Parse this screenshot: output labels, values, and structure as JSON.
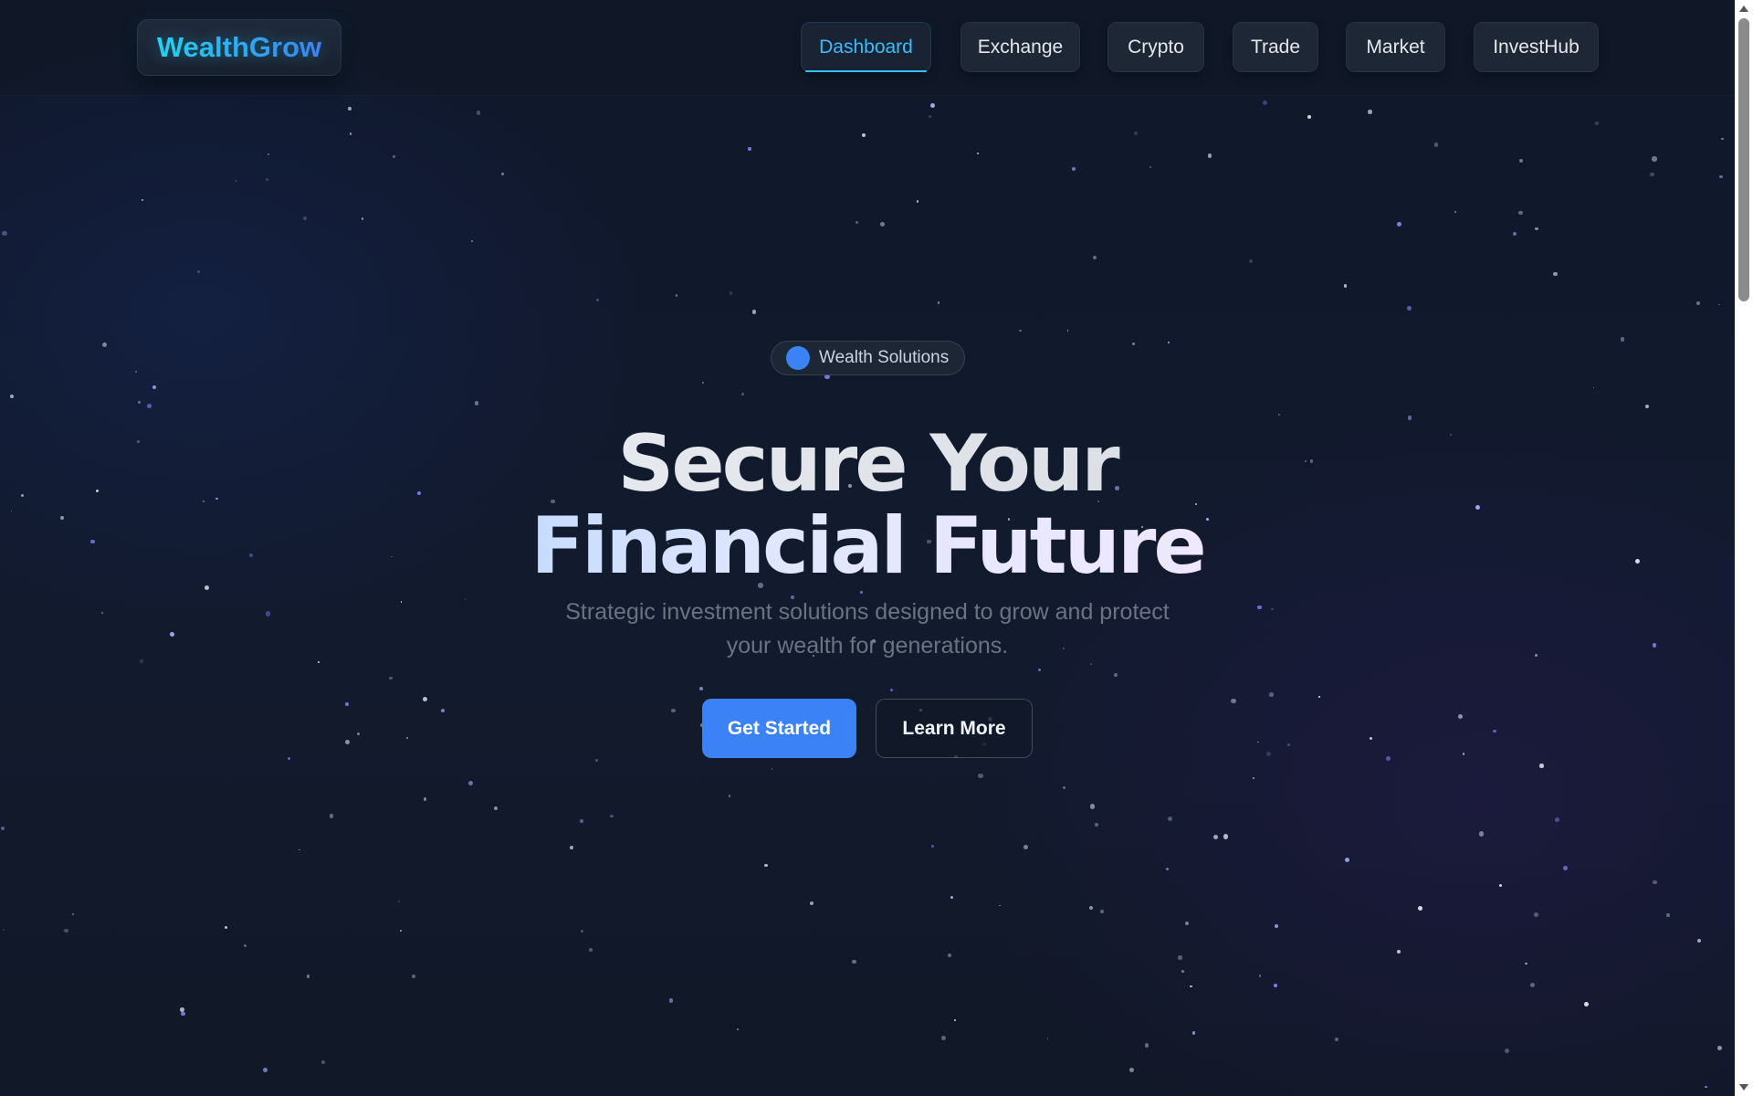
{
  "header": {
    "logo": "WealthGrow",
    "nav": [
      {
        "label": "Dashboard",
        "active": true
      },
      {
        "label": "Exchange",
        "active": false
      },
      {
        "label": "Crypto",
        "active": false
      },
      {
        "label": "Trade",
        "active": false
      },
      {
        "label": "Market",
        "active": false
      },
      {
        "label": "InvestHub",
        "active": false
      }
    ]
  },
  "hero": {
    "badge": "Wealth Solutions",
    "title_line1": "Secure Your",
    "title_line2": "Financial Future",
    "subtitle": "Strategic investment solutions designed to grow and protect your wealth for generations.",
    "primary_button": "Get Started",
    "secondary_button": "Learn More"
  },
  "colors": {
    "background": "#111827",
    "accent": "#3b82f6",
    "logo": "#22d3ee",
    "active_nav": "#38bdf8"
  }
}
